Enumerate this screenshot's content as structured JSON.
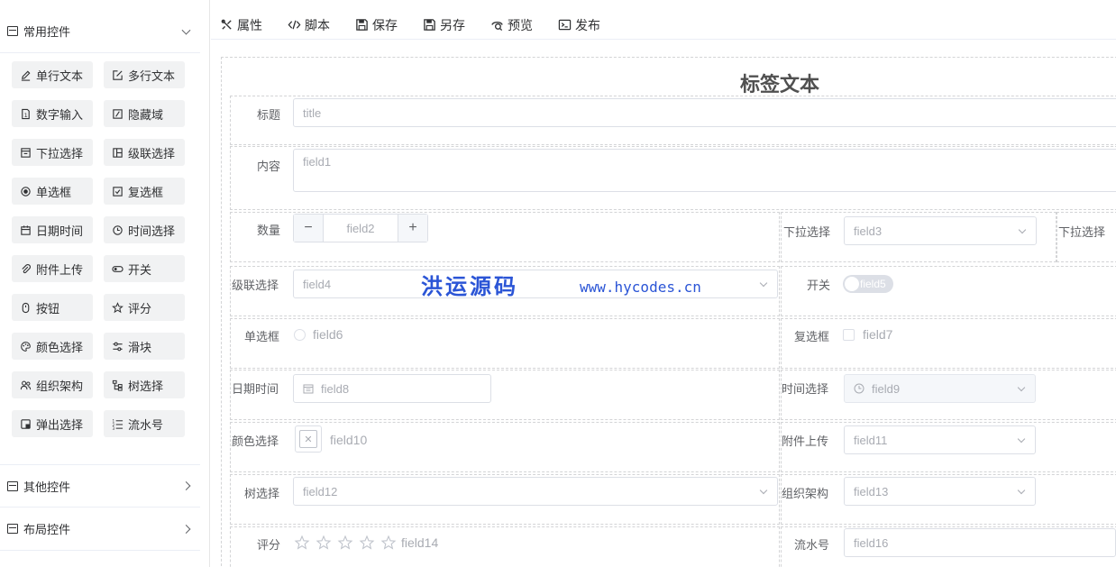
{
  "sidebar": {
    "common_group": {
      "label": "常用控件"
    },
    "components": [
      {
        "label": "单行文本",
        "icon": "edit-icon"
      },
      {
        "label": "多行文本",
        "icon": "textarea-icon"
      },
      {
        "label": "数字输入",
        "icon": "number-icon"
      },
      {
        "label": "隐藏域",
        "icon": "hidden-icon"
      },
      {
        "label": "下拉选择",
        "icon": "select-icon"
      },
      {
        "label": "级联选择",
        "icon": "cascader-icon"
      },
      {
        "label": "单选框",
        "icon": "radio-icon"
      },
      {
        "label": "复选框",
        "icon": "checkbox-icon"
      },
      {
        "label": "日期时间",
        "icon": "calendar-icon"
      },
      {
        "label": "时间选择",
        "icon": "clock-icon"
      },
      {
        "label": "附件上传",
        "icon": "paperclip-icon"
      },
      {
        "label": "开关",
        "icon": "switch-icon"
      },
      {
        "label": "按钮",
        "icon": "button-icon"
      },
      {
        "label": "评分",
        "icon": "star-icon"
      },
      {
        "label": "颜色选择",
        "icon": "palette-icon"
      },
      {
        "label": "滑块",
        "icon": "slider-icon"
      },
      {
        "label": "组织架构",
        "icon": "users-icon"
      },
      {
        "label": "树选择",
        "icon": "tree-icon"
      },
      {
        "label": "弹出选择",
        "icon": "popup-icon"
      },
      {
        "label": "流水号",
        "icon": "list-number-icon"
      }
    ],
    "other_group": {
      "label": "其他控件"
    },
    "layout_group": {
      "label": "布局控件"
    }
  },
  "toolbar": {
    "props": "属性",
    "script": "脚本",
    "save": "保存",
    "save_as": "另存",
    "preview": "预览",
    "publish": "发布"
  },
  "form": {
    "title": "标签文本",
    "title_field": {
      "label": "标题",
      "placeholder": "title"
    },
    "content_field": {
      "label": "内容",
      "placeholder": "field1"
    },
    "quantity_field": {
      "label": "数量",
      "placeholder": "field2",
      "minus": "−",
      "plus": "+"
    },
    "select_field": {
      "label": "下拉选择",
      "placeholder": "field3"
    },
    "select_field_2": {
      "label": "下拉选择"
    },
    "cascader_field": {
      "label": "级联选择",
      "placeholder": "field4"
    },
    "switch_field": {
      "label": "开关",
      "placeholder": "field5"
    },
    "radio_field": {
      "label": "单选框",
      "placeholder": "field6"
    },
    "checkbox_field": {
      "label": "复选框",
      "placeholder": "field7"
    },
    "datetime_field": {
      "label": "日期时间",
      "placeholder": "field8"
    },
    "time_field": {
      "label": "时间选择",
      "placeholder": "field9"
    },
    "color_field": {
      "label": "颜色选择",
      "placeholder": "field10"
    },
    "upload_field": {
      "label": "附件上传",
      "placeholder": "field11"
    },
    "tree_field": {
      "label": "树选择",
      "placeholder": "field12"
    },
    "org_field": {
      "label": "组织架构",
      "placeholder": "field13"
    },
    "rate_field": {
      "label": "评分",
      "placeholder": "field14"
    },
    "serial_field": {
      "label": "流水号",
      "placeholder": "field16"
    }
  },
  "watermark": {
    "brand": "洪运源码",
    "url": "www.hycodes.cn"
  }
}
